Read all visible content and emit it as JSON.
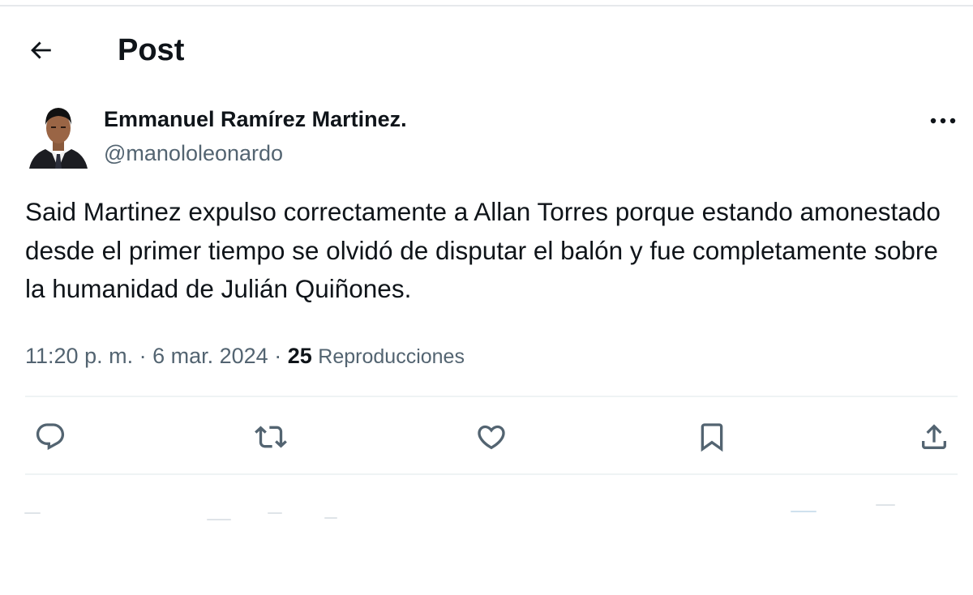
{
  "header": {
    "title": "Post",
    "back_icon": "arrow-left-icon"
  },
  "author": {
    "display_name": "Emmanuel Ramírez Martinez.",
    "handle": "@manololeonardo",
    "avatar_icon": "avatar-photo"
  },
  "tweet": {
    "text": "Said Martinez expulso correctamente a Allan Torres porque estando amonestado desde el primer tiempo se olvidó de disputar el balón y fue completamente sobre la humanidad de Julián Quiñones.",
    "time": "11:20 p. m.",
    "separator": "·",
    "date": "6 mar. 2024",
    "views_count": "25",
    "views_label": "Reproducciones"
  },
  "actions": [
    {
      "name": "reply",
      "icon": "reply-bubble-icon"
    },
    {
      "name": "repost",
      "icon": "repost-icon"
    },
    {
      "name": "like",
      "icon": "heart-icon"
    },
    {
      "name": "bookmark",
      "icon": "bookmark-icon"
    },
    {
      "name": "share",
      "icon": "share-upload-icon"
    }
  ],
  "colors": {
    "text_primary": "#0f1419",
    "text_secondary": "#536471",
    "divider": "#eff3f4",
    "background": "#ffffff"
  }
}
